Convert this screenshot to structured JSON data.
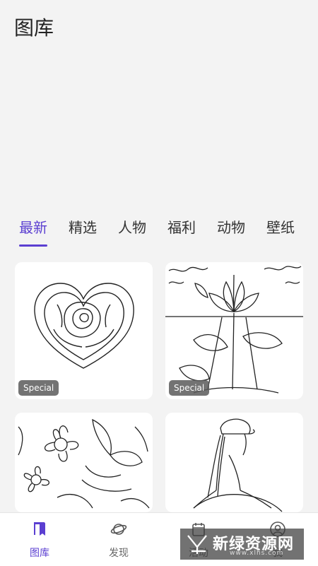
{
  "header": {
    "title": "图库"
  },
  "tabs": [
    {
      "label": "最新",
      "active": true
    },
    {
      "label": "精选",
      "active": false
    },
    {
      "label": "人物",
      "active": false
    },
    {
      "label": "福利",
      "active": false
    },
    {
      "label": "动物",
      "active": false
    },
    {
      "label": "壁纸",
      "active": false
    }
  ],
  "cards": [
    {
      "subject": "heart-rose",
      "badge": "Special"
    },
    {
      "subject": "lotus",
      "badge": "Special"
    },
    {
      "subject": "flowers-butterfly",
      "badge": ""
    },
    {
      "subject": "girl-with-cap",
      "badge": ""
    }
  ],
  "bottom_nav": [
    {
      "label": "图库",
      "icon": "gallery-icon",
      "active": true
    },
    {
      "label": "发现",
      "icon": "planet-icon",
      "active": false
    },
    {
      "label": "活动",
      "icon": "calendar-icon",
      "active": false
    },
    {
      "label": "我",
      "icon": "user-icon",
      "active": false
    }
  ],
  "watermark": {
    "text": "新绿资源网",
    "sub": "www.xlhs.com"
  },
  "colors": {
    "accent": "#5b3fd1",
    "background": "#f3f3f3"
  }
}
